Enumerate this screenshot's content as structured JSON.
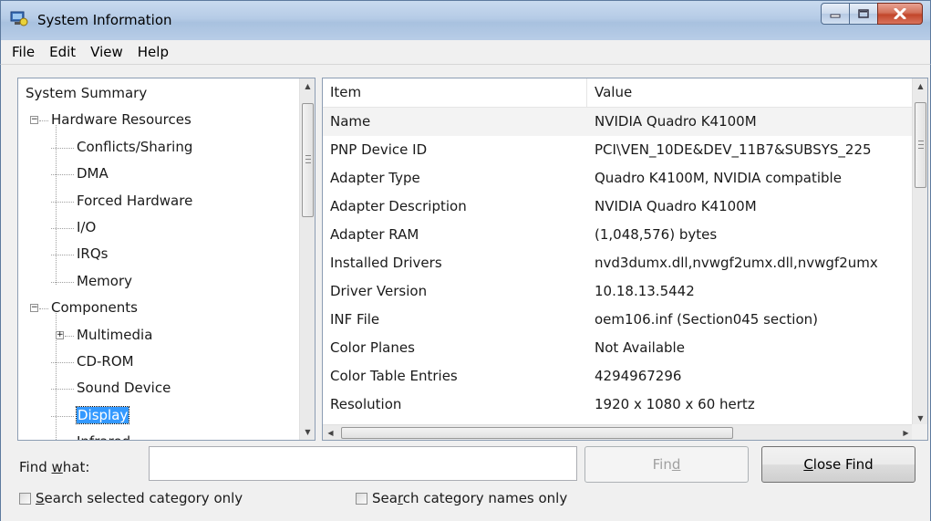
{
  "window": {
    "title": "System Information"
  },
  "menu": [
    "File",
    "Edit",
    "View",
    "Help"
  ],
  "tree": {
    "items": [
      {
        "label": "System Summary",
        "level": 0
      },
      {
        "label": "Hardware Resources",
        "level": 1,
        "expander": "−"
      },
      {
        "label": "Conflicts/Sharing",
        "level": 2
      },
      {
        "label": "DMA",
        "level": 2
      },
      {
        "label": "Forced Hardware",
        "level": 2
      },
      {
        "label": "I/O",
        "level": 2
      },
      {
        "label": "IRQs",
        "level": 2
      },
      {
        "label": "Memory",
        "level": 2
      },
      {
        "label": "Components",
        "level": 1,
        "expander": "−"
      },
      {
        "label": "Multimedia",
        "level": 2,
        "expander": "+"
      },
      {
        "label": "CD-ROM",
        "level": 2
      },
      {
        "label": "Sound Device",
        "level": 2
      },
      {
        "label": "Display",
        "level": 2,
        "selected": true
      },
      {
        "label": "Infrared",
        "level": 2
      }
    ]
  },
  "details": {
    "headers": {
      "item": "Item",
      "value": "Value"
    },
    "rows": [
      {
        "item": "Name",
        "value": "NVIDIA Quadro K4100M"
      },
      {
        "item": "PNP Device ID",
        "value": "PCI\\VEN_10DE&DEV_11B7&SUBSYS_225"
      },
      {
        "item": "Adapter Type",
        "value": "Quadro K4100M, NVIDIA compatible"
      },
      {
        "item": "Adapter Description",
        "value": "NVIDIA Quadro K4100M"
      },
      {
        "item": "Adapter RAM",
        "value": "(1,048,576) bytes"
      },
      {
        "item": "Installed Drivers",
        "value": "nvd3dumx.dll,nvwgf2umx.dll,nvwgf2umx"
      },
      {
        "item": "Driver Version",
        "value": "10.18.13.5442"
      },
      {
        "item": "INF File",
        "value": "oem106.inf (Section045 section)"
      },
      {
        "item": "Color Planes",
        "value": "Not Available"
      },
      {
        "item": "Color Table Entries",
        "value": "4294967296"
      },
      {
        "item": "Resolution",
        "value": "1920 x 1080 x 60 hertz"
      }
    ]
  },
  "find": {
    "label_pre": "Find ",
    "label_key": "w",
    "label_post": "hat:",
    "value": "",
    "find_pre": "Fin",
    "find_key": "d",
    "find_post": "",
    "close_pre": "",
    "close_key": "C",
    "close_post": "lose Find",
    "find_enabled": false
  },
  "options": {
    "search_selected": {
      "pre": "",
      "key": "S",
      "post": "earch selected category only",
      "checked": false
    },
    "search_names": {
      "pre": "Sea",
      "key": "r",
      "post": "ch category names only",
      "checked": false
    }
  },
  "colors": {
    "selection": "#3399ff",
    "close_button": "#c2462b",
    "titlebar": "#b5cbe6"
  },
  "icons": [
    "system-information-app-icon",
    "minimize-icon",
    "maximize-icon",
    "close-icon",
    "scroll-up-icon",
    "scroll-down-icon",
    "scroll-left-icon",
    "scroll-right-icon"
  ]
}
